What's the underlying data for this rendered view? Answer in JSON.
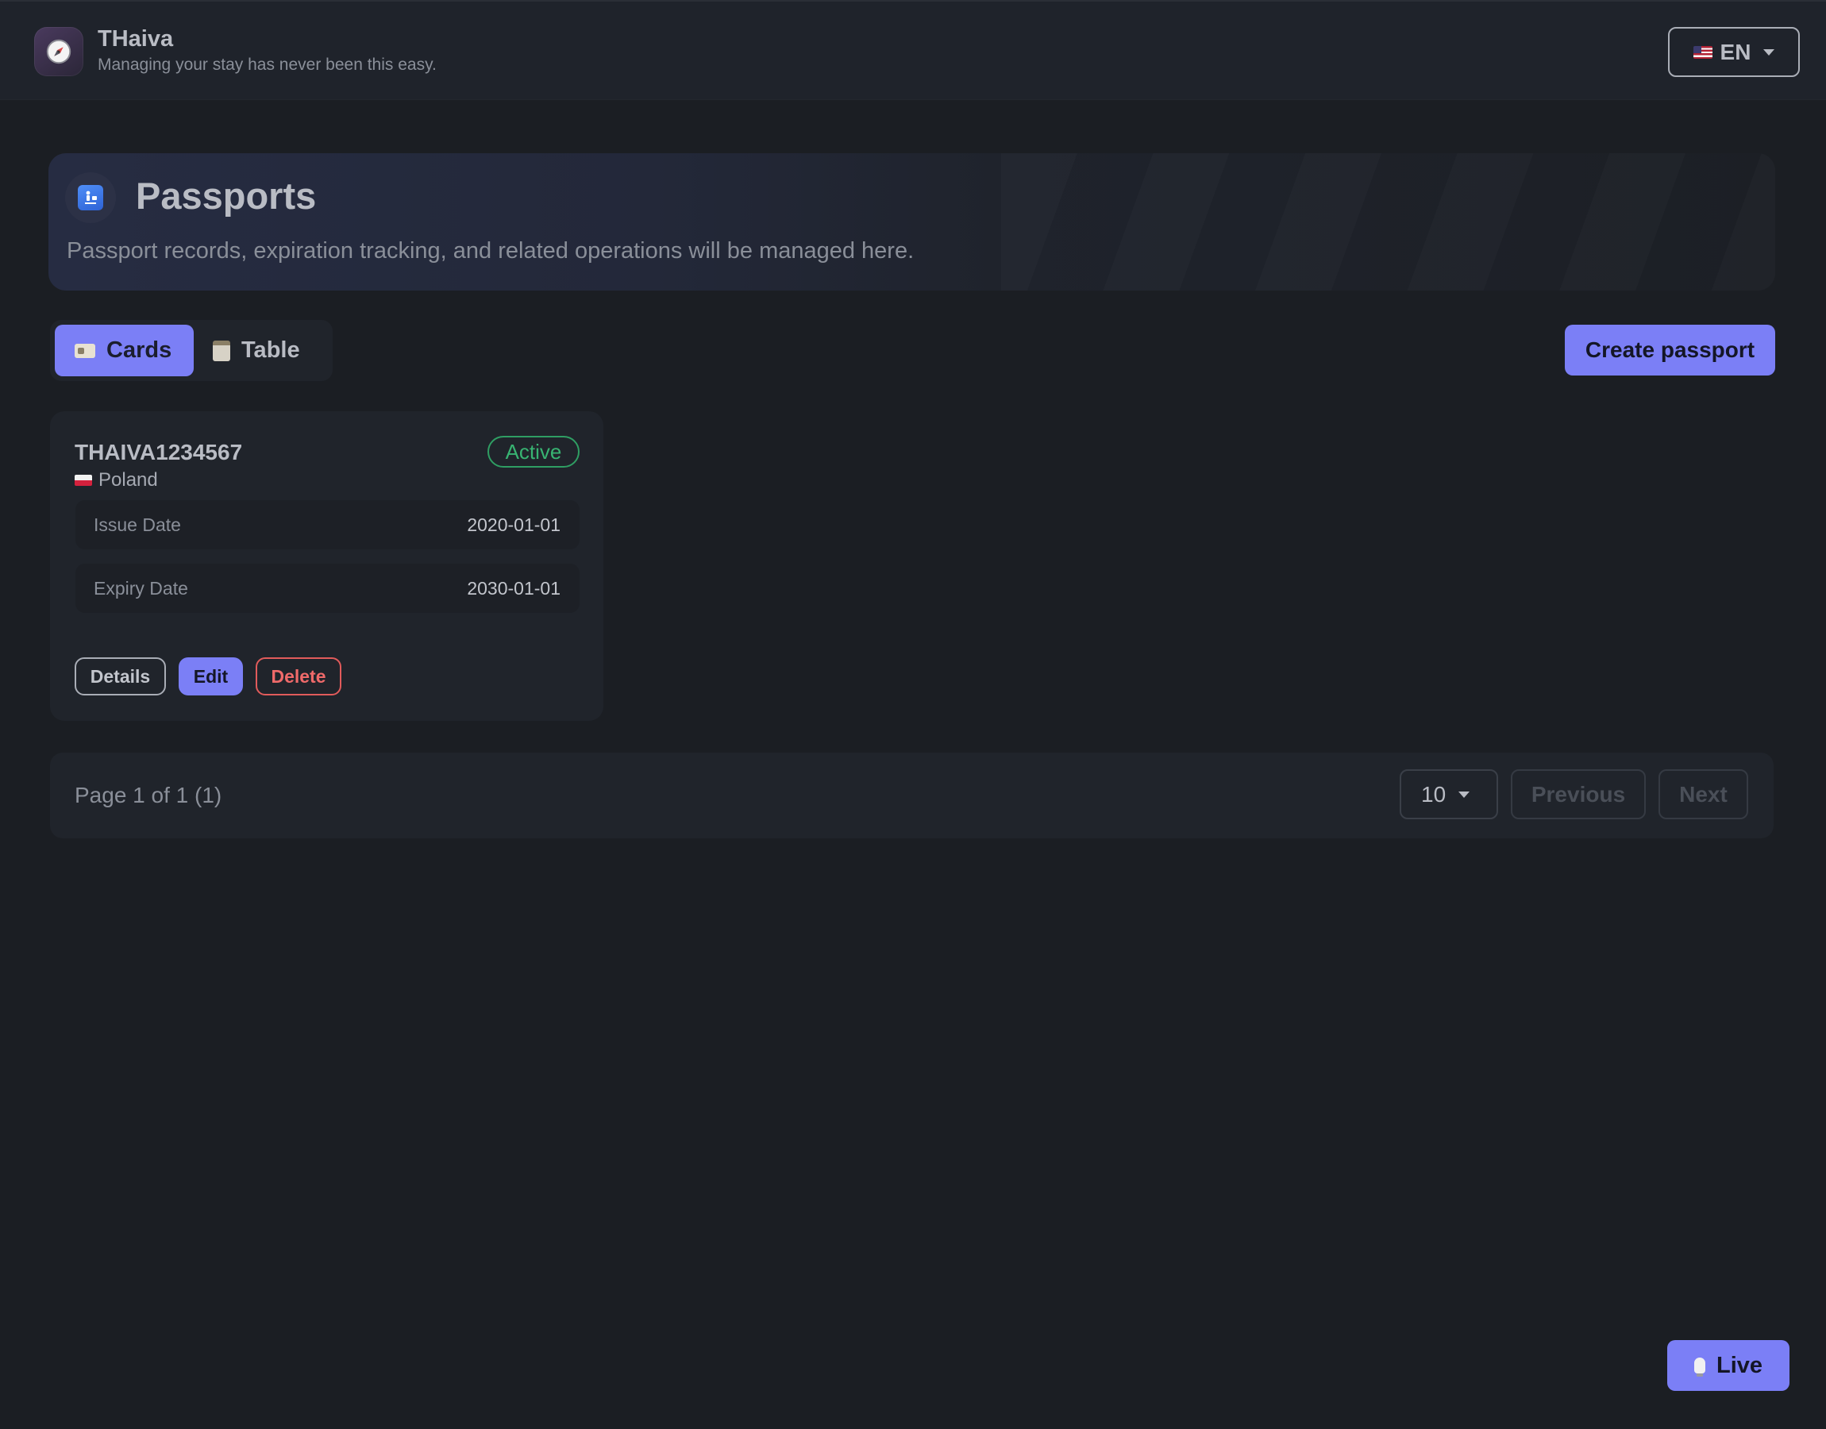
{
  "header": {
    "title": "THaiva",
    "subtitle": "Managing your stay has never been this easy.",
    "language": {
      "label": "EN",
      "flag_icon": "flag-us-icon"
    }
  },
  "page": {
    "title": "Passports",
    "description": "Passport records, expiration tracking, and related operations will be managed here."
  },
  "view_toggle": {
    "options": [
      {
        "label": "Cards",
        "icon": "card-icon",
        "active": true
      },
      {
        "label": "Table",
        "icon": "clipboard-icon",
        "active": false
      }
    ]
  },
  "actions": {
    "create_label": "Create passport"
  },
  "passports": [
    {
      "number": "THAIVA1234567",
      "country": "Poland",
      "status": "Active",
      "fields": [
        {
          "label": "Issue Date",
          "value": "2020-01-01"
        },
        {
          "label": "Expiry Date",
          "value": "2030-01-01"
        }
      ],
      "buttons": {
        "details": "Details",
        "edit": "Edit",
        "delete": "Delete"
      }
    }
  ],
  "pagination": {
    "summary": "Page 1 of 1 (1)",
    "page_size": "10",
    "previous_label": "Previous",
    "next_label": "Next"
  },
  "live": {
    "label": "Live"
  },
  "colors": {
    "accent": "#7b7ff6",
    "active_status": "#38b372",
    "danger": "#f06a6a",
    "background": "#1b1e23"
  }
}
